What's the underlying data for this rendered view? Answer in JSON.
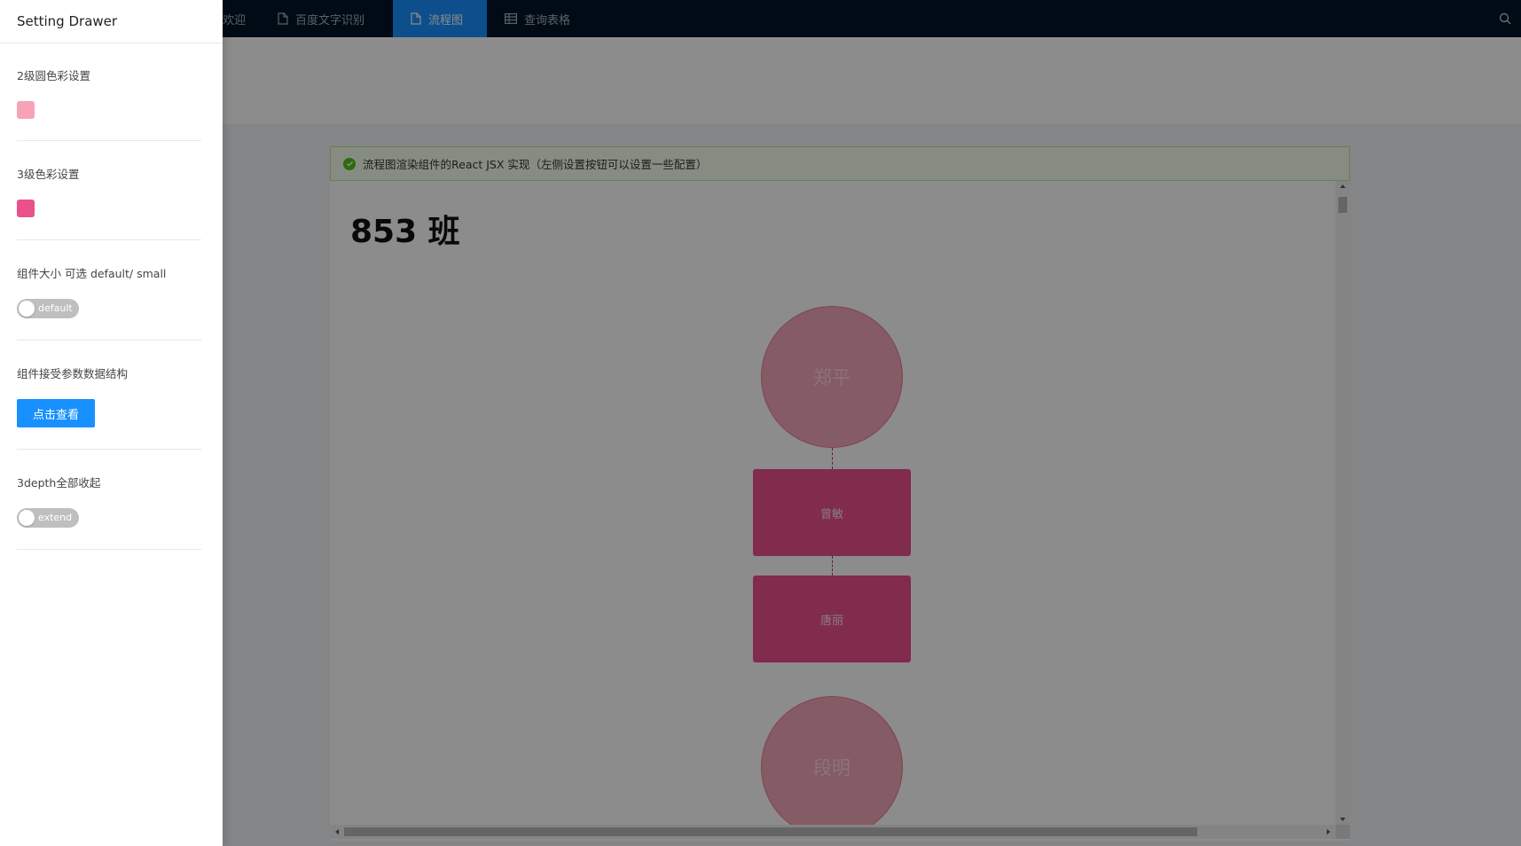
{
  "topnav": {
    "tabs": [
      {
        "label": "欢迎",
        "icon": "none"
      },
      {
        "label": "百度文字识别",
        "icon": "file-icon"
      },
      {
        "label": "流程图",
        "icon": "file-icon",
        "active": true
      },
      {
        "label": "查询表格",
        "icon": "table-icon"
      }
    ],
    "search_icon": "search-icon"
  },
  "drawer": {
    "title": "Setting Drawer",
    "sections": [
      {
        "label": "2级圆色彩设置",
        "type": "color",
        "color": "#f7a3b5"
      },
      {
        "label": "3级色彩设置",
        "type": "color",
        "color": "#eb4f8c"
      },
      {
        "label": "组件大小 可选 default/ small",
        "type": "switch",
        "switch_text": "default",
        "checked": false
      },
      {
        "label": "组件接受参数数据结构",
        "type": "button",
        "button_label": "点击查看"
      },
      {
        "label": "3depth全部收起",
        "type": "switch",
        "switch_text": "extend",
        "checked": false
      }
    ]
  },
  "content": {
    "alert_text": "流程图渲染组件的React JSX 实现（左侧设置按钮可以设置一些配置）",
    "alert_type": "success",
    "class_title": "853 班",
    "nodes": [
      {
        "label": "郑平",
        "shape": "circle",
        "level": 2
      },
      {
        "label": "曾敏",
        "shape": "rect",
        "level": 3
      },
      {
        "label": "唐丽",
        "shape": "rect",
        "level": 3
      },
      {
        "label": "段明",
        "shape": "circle",
        "level": 2
      }
    ]
  },
  "colors": {
    "nav_bg": "#001529",
    "nav_active": "#1890ff",
    "primary": "#1890ff",
    "circle_fill": "#f3a6b8",
    "rect_fill": "#eb4f8c",
    "mask": "rgba(0,0,0,0.45)"
  }
}
